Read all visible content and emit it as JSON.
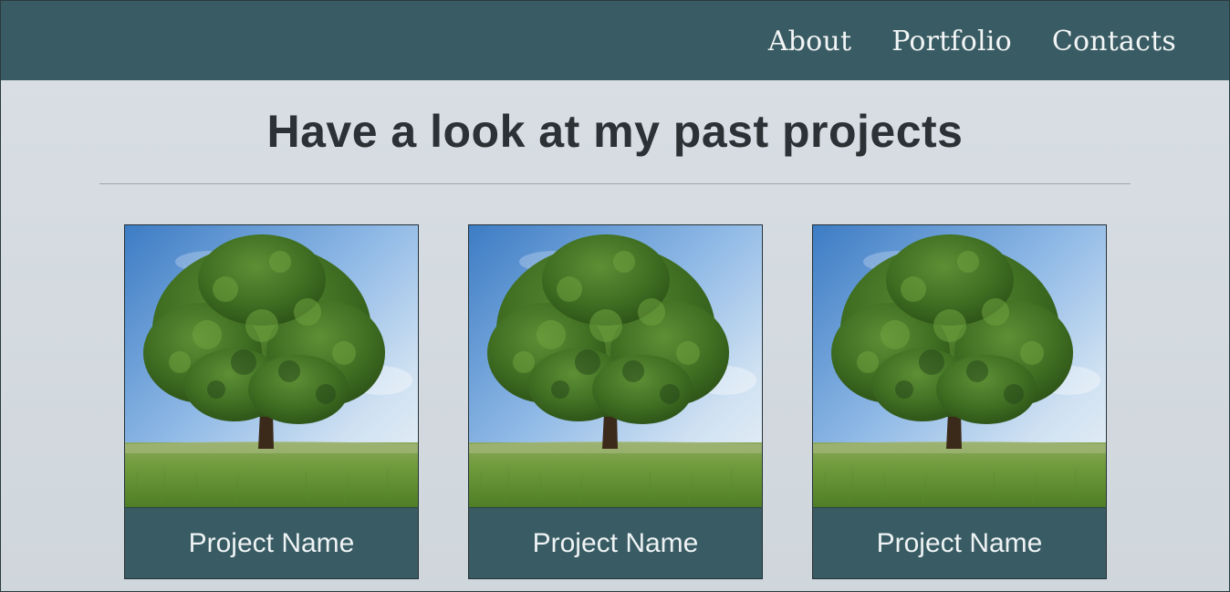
{
  "nav": {
    "links": [
      "About",
      "Portfolio",
      "Contacts"
    ]
  },
  "main": {
    "title": "Have a look at my past projects",
    "projects": [
      {
        "name": "Project Name",
        "image": "tree-in-meadow"
      },
      {
        "name": "Project Name",
        "image": "tree-in-meadow"
      },
      {
        "name": "Project Name",
        "image": "tree-in-meadow"
      }
    ]
  },
  "colors": {
    "navbar": "#395b63",
    "background": "#d9dfe4",
    "title": "#2b3134",
    "caption_bg": "#395b63"
  }
}
